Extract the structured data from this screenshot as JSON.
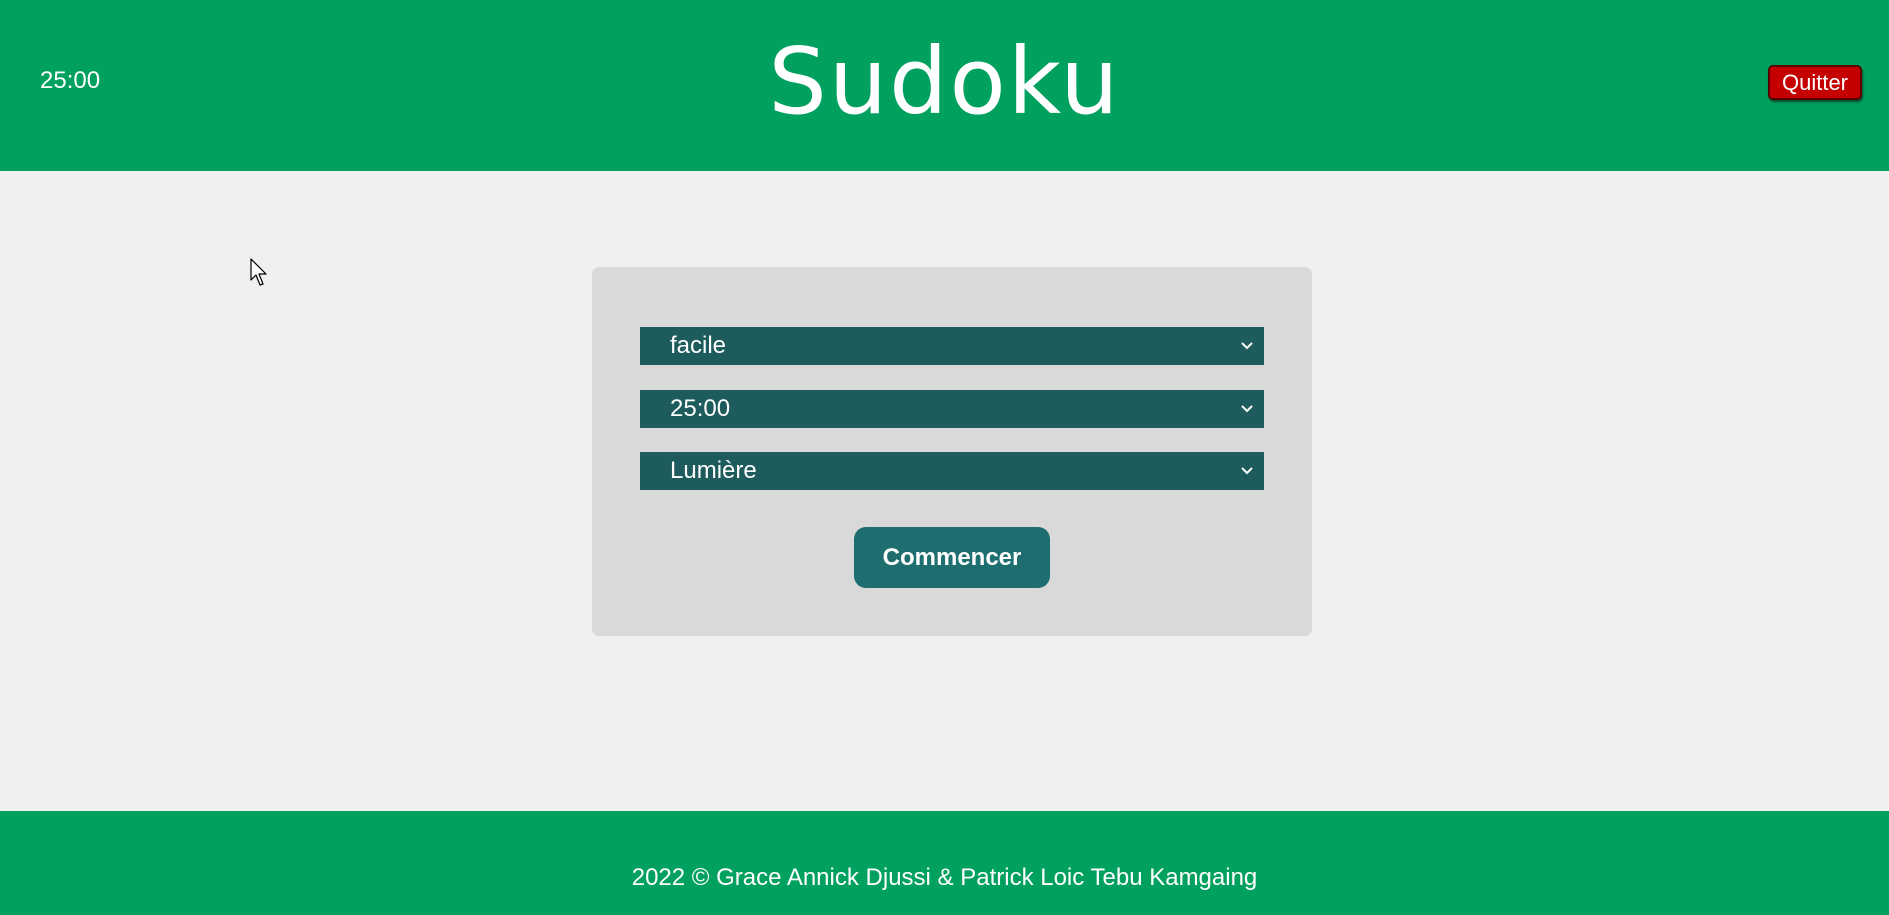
{
  "header": {
    "timer": "25:00",
    "title": "Sudoku",
    "quit_label": "Quitter"
  },
  "settings": {
    "difficulty": {
      "selected": "facile"
    },
    "duration": {
      "selected": "25:00"
    },
    "theme": {
      "selected": "Lumière"
    },
    "start_label": "Commencer"
  },
  "footer": {
    "text": "2022 © Grace Annick Djussi & Patrick Loic Tebu Kamgaing"
  },
  "colors": {
    "brand_green": "#00a05e",
    "select_bg": "#1e5b5c",
    "button_bg": "#1f6e6f",
    "quit_red": "#c40000",
    "panel_bg": "#d9d9d9",
    "page_bg": "#f0f0f0"
  },
  "icons": {
    "select_arrow": "chevron-down-icon",
    "pointer": "mouse-cursor-icon"
  }
}
